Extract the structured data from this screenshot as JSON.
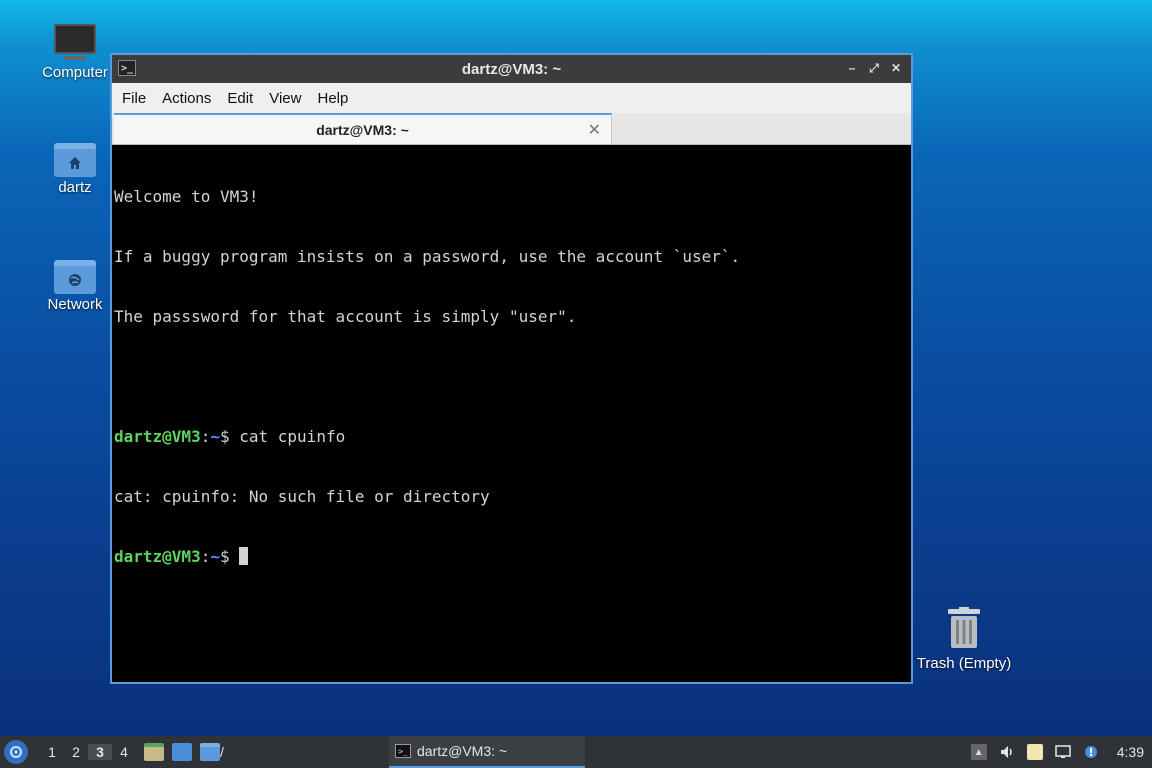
{
  "desktop": {
    "icons": [
      {
        "label": "Computer"
      },
      {
        "label": "dartz"
      },
      {
        "label": "Network"
      },
      {
        "label": "Trash (Empty)"
      }
    ]
  },
  "window": {
    "title": "dartz@VM3: ~",
    "menu": [
      "File",
      "Actions",
      "Edit",
      "View",
      "Help"
    ],
    "tab_label": "dartz@VM3: ~"
  },
  "terminal": {
    "motd": [
      "Welcome to VM3!",
      "If a buggy program insists on a password, use the account `user`.",
      "The passsword for that account is simply \"user\"."
    ],
    "prompt_user": "dartz@VM3",
    "prompt_sep": ":",
    "prompt_path": "~",
    "prompt_end": "$ ",
    "command": "cat cpuinfo",
    "error": "cat: cpuinfo: No such file or directory"
  },
  "taskbar": {
    "workspaces": [
      "1",
      "2",
      "3",
      "4"
    ],
    "active_workspace": "3",
    "path_label": "/",
    "task_title": "dartz@VM3: ~",
    "clock": "4:39"
  }
}
